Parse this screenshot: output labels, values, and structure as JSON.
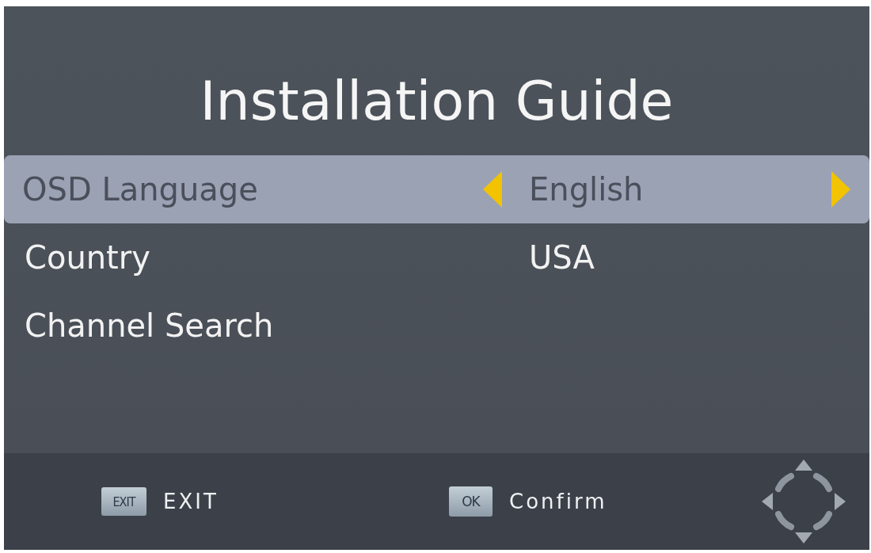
{
  "title": "Installation Guide",
  "menu": {
    "items": [
      {
        "label": "OSD Language",
        "value": "English",
        "selected": true
      },
      {
        "label": "Country",
        "value": "USA",
        "selected": false
      },
      {
        "label": "Channel Search",
        "selected": false
      }
    ]
  },
  "footer": {
    "hints": [
      {
        "key": "EXIT",
        "label": "EXIT"
      },
      {
        "key": "OK",
        "label": "Confirm"
      }
    ]
  }
}
